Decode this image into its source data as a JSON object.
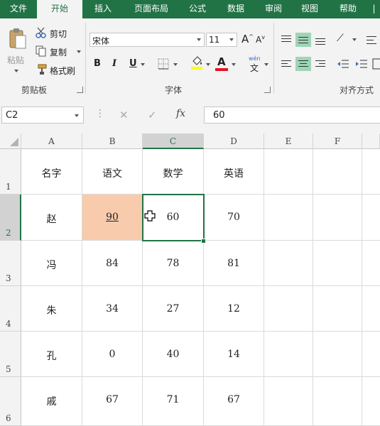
{
  "ribbon_tabs": [
    "文件",
    "开始",
    "插入",
    "页面布局",
    "公式",
    "数据",
    "审阅",
    "视图",
    "帮助"
  ],
  "active_tab": "开始",
  "clipboard": {
    "paste": "粘贴",
    "cut": "剪切",
    "copy": "复制",
    "format_painter": "格式刷",
    "group_label": "剪贴板"
  },
  "font": {
    "name": "宋体",
    "size": "11",
    "bold": "B",
    "italic": "I",
    "underline": "U",
    "font_color_letter": "A",
    "phonetic_top": "wén",
    "phonetic_char": "文",
    "group_label": "字体"
  },
  "alignment": {
    "group_label": "对齐方式"
  },
  "formula_bar": {
    "name_box": "C2",
    "cancel": "✕",
    "enter": "✓",
    "fx": "fx",
    "formula": "60"
  },
  "columns": [
    "A",
    "B",
    "C",
    "D",
    "E",
    "F"
  ],
  "rows": [
    {
      "num": "1",
      "cells": [
        "名字",
        "语文",
        "数学",
        "英语",
        "",
        ""
      ]
    },
    {
      "num": "2",
      "cells": [
        "赵",
        "90",
        "60",
        "70",
        "",
        ""
      ]
    },
    {
      "num": "3",
      "cells": [
        "冯",
        "84",
        "78",
        "81",
        "",
        ""
      ]
    },
    {
      "num": "4",
      "cells": [
        "朱",
        "34",
        "27",
        "12",
        "",
        ""
      ]
    },
    {
      "num": "5",
      "cells": [
        "孔",
        "0",
        "40",
        "14",
        "",
        ""
      ]
    },
    {
      "num": "6",
      "cells": [
        "戚",
        "67",
        "71",
        "67",
        "",
        ""
      ]
    }
  ],
  "selected_cell": "C2",
  "highlighted_cell": "B2",
  "colors": {
    "accent": "#217346",
    "highlight_fill": "#f8cbad",
    "font_color_bar": "#e81123",
    "fill_color_bar": "#ffff00"
  }
}
